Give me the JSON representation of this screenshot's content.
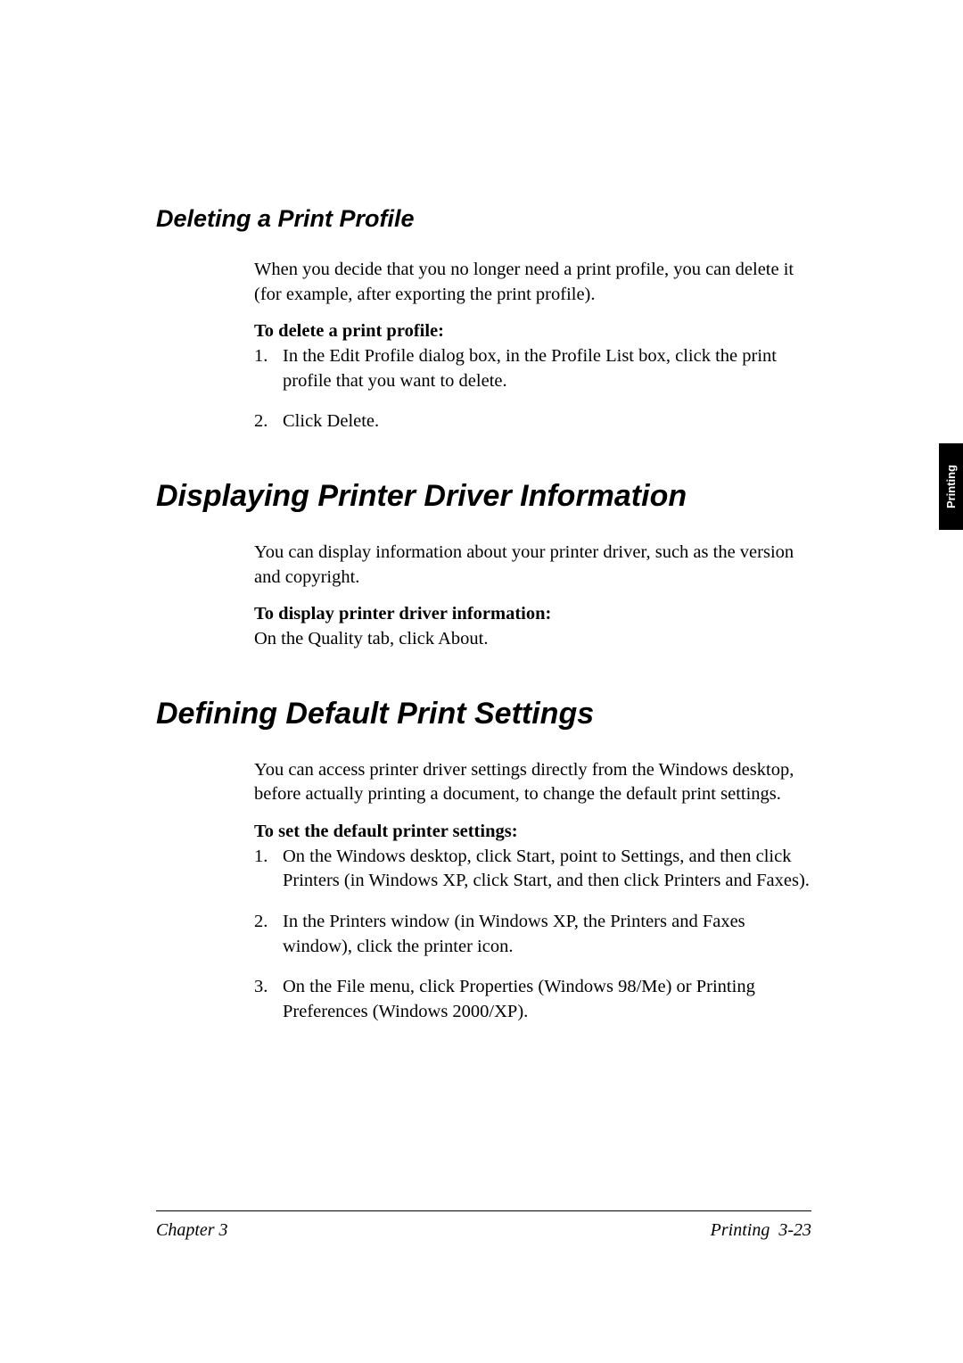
{
  "h3_deleting": "Deleting a Print Profile",
  "deleting_intro": "When you decide that you no longer need a print profile, you can delete it (for example, after exporting the print profile).",
  "deleting_bold": "To delete a print profile:",
  "deleting_step1": "In the Edit Profile dialog box, in the Profile List box, click the print profile that you want to delete.",
  "deleting_step2": "Click Delete.",
  "h2_displaying": "Displaying Printer Driver Information",
  "displaying_intro": "You can display information about your printer driver, such as the version and copyright.",
  "displaying_bold": "To display printer driver information:",
  "displaying_step": "On the Quality tab, click About.",
  "h2_defining": "Defining Default Print Settings",
  "defining_intro": "You can access printer driver settings directly from the Windows desktop, before actually printing a document, to change the default print settings.",
  "defining_bold": "To set the default printer settings:",
  "defining_step1": "On the Windows desktop, click Start, point to Settings, and then click Printers (in Windows XP, click Start, and then click Printers and Faxes).",
  "defining_step2": "In the Printers window (in Windows XP, the Printers and Faxes window), click the printer icon.",
  "defining_step3": "On the File menu, click Properties (Windows 98/Me) or Printing Preferences (Windows 2000/XP).",
  "side_tab": "Printing",
  "footer_left": "Chapter 3",
  "footer_section": "Printing",
  "footer_pagenum": "3-23",
  "num1": "1.",
  "num2": "2.",
  "num3": "3."
}
